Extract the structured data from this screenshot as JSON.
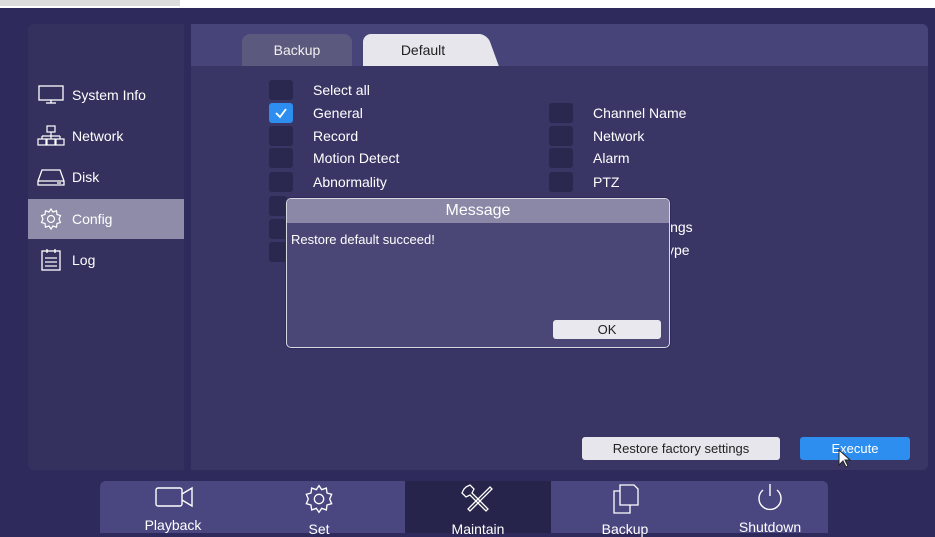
{
  "sidebar": {
    "items": [
      {
        "label": "System Info",
        "icon": "monitor-icon"
      },
      {
        "label": "Network",
        "icon": "network-icon"
      },
      {
        "label": "Disk",
        "icon": "disk-icon"
      },
      {
        "label": "Config",
        "icon": "gear-icon",
        "active": true
      },
      {
        "label": "Log",
        "icon": "log-icon"
      }
    ]
  },
  "tabs": [
    {
      "label": "Backup"
    },
    {
      "label": "Default",
      "active": true
    }
  ],
  "options": {
    "select_all": {
      "label": "Select all",
      "checked": false
    },
    "left": [
      {
        "label": "General",
        "checked": true
      },
      {
        "label": "Record",
        "checked": false
      },
      {
        "label": "Motion Detect",
        "checked": false
      },
      {
        "label": "Abnormality",
        "checked": false
      }
    ],
    "right": [
      {
        "label": "Channel Name",
        "checked": false
      },
      {
        "label": "Network",
        "checked": false
      },
      {
        "label": "Alarm",
        "checked": false
      },
      {
        "label": "PTZ",
        "checked": false
      }
    ],
    "partial_right": [
      "ings",
      "ype"
    ]
  },
  "dialog": {
    "title": "Message",
    "message": "Restore default succeed!",
    "ok_label": "OK"
  },
  "buttons": {
    "restore_label": "Restore factory settings",
    "execute_label": "Execute"
  },
  "dock": {
    "items": [
      {
        "label": "Playback",
        "icon": "camera-icon"
      },
      {
        "label": "Set",
        "icon": "gear-icon"
      },
      {
        "label": "Maintain",
        "icon": "tools-icon",
        "active": true
      },
      {
        "label": "Backup",
        "icon": "copy-icon"
      },
      {
        "label": "Shutdown",
        "icon": "power-icon"
      }
    ]
  },
  "colors": {
    "background": "#2e2b5c",
    "panel": "#393665",
    "accent": "#2d8ef0",
    "active_sidebar": "#8e8ca8"
  }
}
